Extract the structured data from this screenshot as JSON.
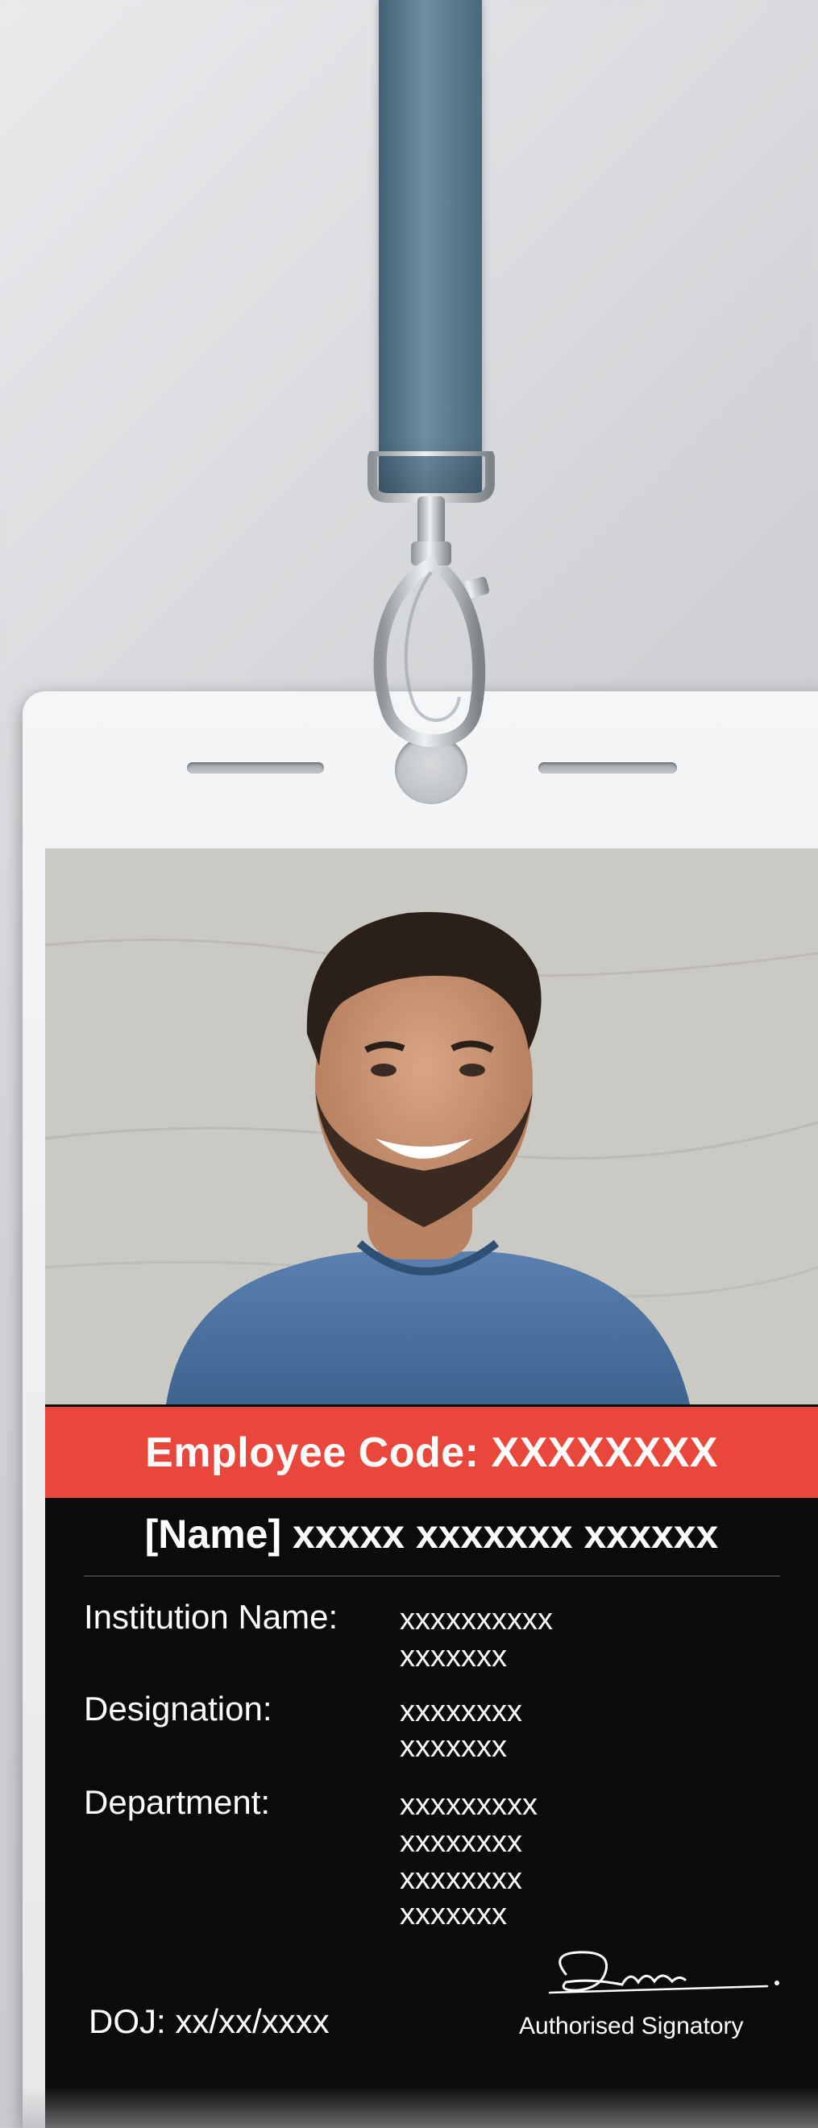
{
  "badge": {
    "employee_code": "Employee Code: XXXXXXXX",
    "name": "[Name] xxxxx xxxxxxx xxxxxx",
    "fields": [
      {
        "label": "Institution Name:",
        "value_lines": [
          "xxxxxxxxxx",
          "xxxxxxx"
        ]
      },
      {
        "label": "Designation:",
        "value_lines": [
          "xxxxxxxx",
          "xxxxxxx"
        ]
      },
      {
        "label": "Department:",
        "value_lines": [
          "xxxxxxxxx",
          "xxxxxxxx",
          "xxxxxxxx",
          "xxxxxxx"
        ]
      }
    ],
    "doj": "DOJ: xx/xx/xxxx",
    "signatory": "Authorised Signatory"
  },
  "colors": {
    "accent_red": "#e9473c",
    "card_black": "#0b0b0b",
    "lanyard_blue": "#5b7a8f"
  },
  "icons": {
    "clip": "lanyard-clip-icon",
    "signature": "signature-icon",
    "photo": "employee-photo"
  }
}
